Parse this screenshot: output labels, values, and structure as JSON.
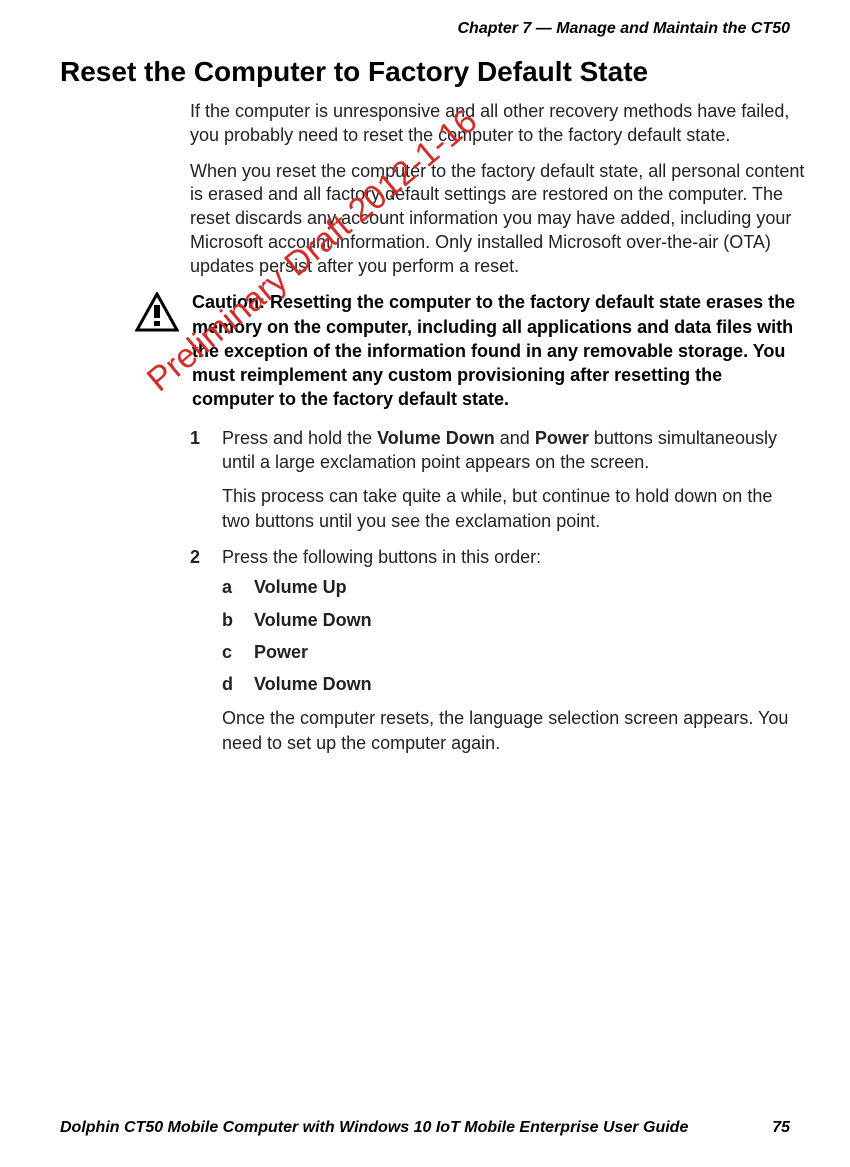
{
  "header": {
    "running": "Chapter 7 — Manage and Maintain the CT50"
  },
  "title": "Reset the Computer to Factory Default State",
  "intro": {
    "p1": "If the computer is unresponsive and all other recovery methods have failed, you probably need to reset the computer to the factory default state.",
    "p2": "When you reset the computer to the factory default state, all personal content is erased and all factory default settings are restored on the computer. The reset discards any account information you may have added, including your Microsoft account information. Only installed Microsoft over-the-air (OTA) updates persist after you perform a reset."
  },
  "caution": "Caution: Resetting the computer to the factory default state erases the memory on the computer, including all applications and data files with the exception of the information found in any removable storage. You must reimplement any custom provisioning after resetting the computer to the factory default state.",
  "steps": {
    "s1": {
      "marker": "1",
      "pre": "Press and hold the ",
      "b1": "Volume Down",
      "mid": " and ",
      "b2": "Power",
      "post": " buttons simultaneously until a large exclamation point appears on the screen.",
      "note": "This process can take quite a while, but continue to hold down on the two buttons until you see the exclamation point."
    },
    "s2": {
      "marker": "2",
      "text": "Press the following buttons in this order:",
      "a": {
        "marker": "a",
        "label": "Volume Up"
      },
      "b": {
        "marker": "b",
        "label": "Volume Down"
      },
      "c": {
        "marker": "c",
        "label": "Power"
      },
      "d": {
        "marker": "d",
        "label": "Volume Down"
      },
      "post": "Once the computer resets, the language selection screen appears. You need to set up the computer again."
    }
  },
  "footer": {
    "left": "Dolphin CT50 Mobile Computer with Windows 10 IoT Mobile Enterprise User Guide",
    "right": "75"
  },
  "watermark": "Preliminary Draft 2012-1-16"
}
